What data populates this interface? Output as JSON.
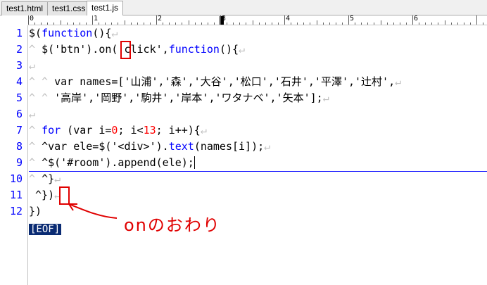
{
  "tabs": [
    {
      "label": "test1.html",
      "active": false
    },
    {
      "label": "test1.css",
      "active": false
    },
    {
      "label": "test1.js",
      "active": true
    }
  ],
  "ruler": {
    "labels": [
      "0",
      "1",
      "2",
      "3",
      "4",
      "5",
      "6"
    ]
  },
  "gutter": {
    "line_numbers": [
      "1",
      "2",
      "3",
      "4",
      "5",
      "6",
      "7",
      "8",
      "9",
      "10",
      "11",
      "12"
    ],
    "current_line": "9"
  },
  "code": {
    "l1": {
      "a": "$(",
      "kw": "function",
      "b": "(){",
      "nl": "↵"
    },
    "l2": {
      "tab": "^ ",
      "a": "$('btn').on(",
      "q": "'",
      "b": "click',",
      "kw": "function",
      "c": "(){",
      "nl": "↵"
    },
    "l3": {
      "nl": "↵"
    },
    "l4": {
      "tab": "^ ^ ",
      "a": "var names=['山浦','森','大谷','松口','石井','平澤','辻村',",
      "nl": "↵"
    },
    "l5": {
      "tab": "^ ^ ",
      "a": "'高岸','岡野','駒井','岸本','ワタナベ','矢本'];",
      "nl": "↵"
    },
    "l6": {
      "nl": "↵"
    },
    "l7": {
      "tab": "^ ",
      "kw": "for",
      "a": " (var i=",
      "n0": "0",
      "b": "; i<",
      "n13": "13",
      "c": "; i++){",
      "nl": "↵"
    },
    "l8": {
      "tab": "^ ",
      "a": "^var ele=$('<div>').",
      "kw": "text",
      "b": "(names[i]);",
      "nl": "↵"
    },
    "l9": {
      "tab": "^ ",
      "a": "^$('#room').append(ele);",
      "nl": "↵"
    },
    "l10": {
      "tab": "^ ",
      "a": "^}",
      "nl": "↵"
    },
    "l11": {
      "tab": " ",
      "a": "^})",
      "nl": "↵"
    },
    "l12": {
      "a": "})"
    },
    "eof": "[EOF]"
  },
  "annotation": {
    "text": "onのおわり",
    "color": "#e00000"
  },
  "colors": {
    "keyword": "#0000ff",
    "number": "#ff0000",
    "line_number": "#0000ff",
    "eof_bg": "#0a2b73"
  }
}
